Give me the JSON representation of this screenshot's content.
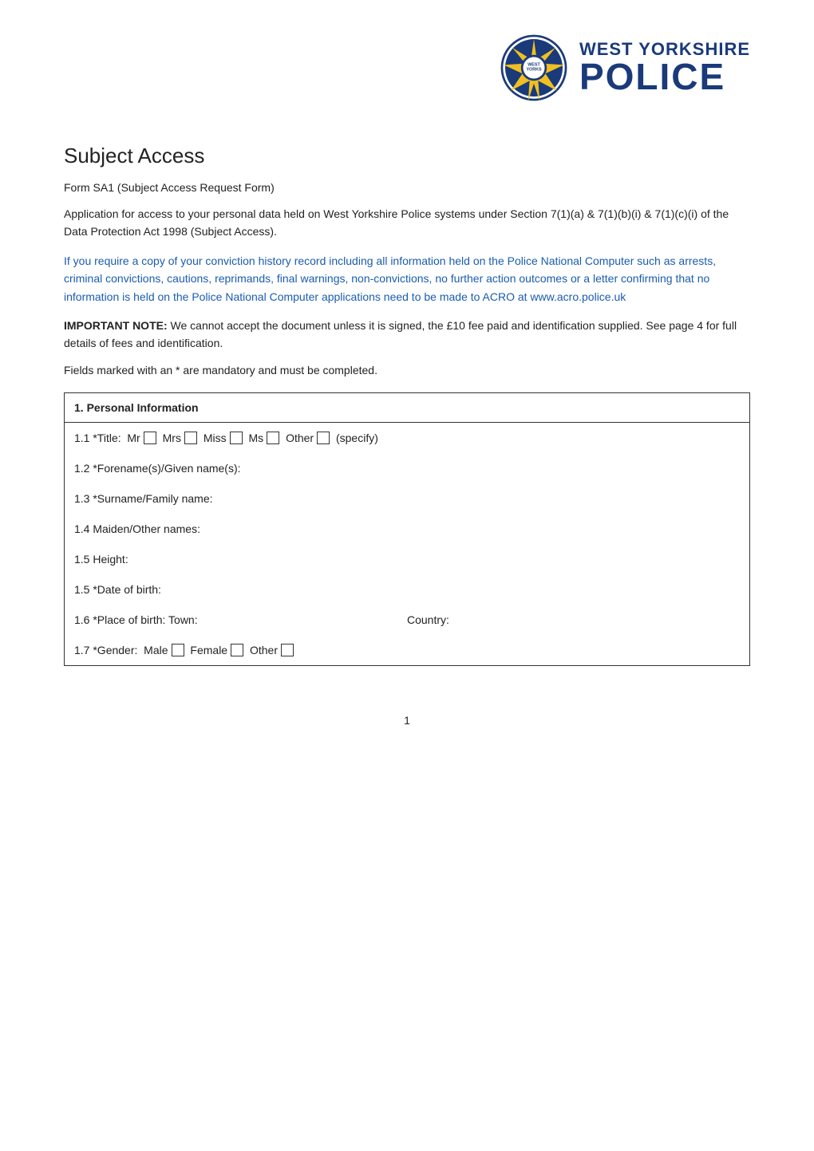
{
  "header": {
    "logo_top": "WEST YORKSHIRE",
    "logo_bottom": "POLICE"
  },
  "page": {
    "title": "Subject Access",
    "subtitle": "Form SA1 (Subject Access Request Form)",
    "intro": "Application for access to your personal data held on West Yorkshire Police systems under Section 7(1)(a) & 7(1)(b)(i) & 7(1)(c)(i) of the Data Protection Act 1998 (Subject Access).",
    "blue_notice": "If you require a copy of your conviction history record including all information held on the Police National Computer such as arrests, criminal convictions, cautions, reprimands, final warnings, non-convictions, no further action outcomes or a letter confirming that no information is held on the Police National Computer applications need to be made to ACRO at www.acro.police.uk",
    "important_note_bold": "IMPORTANT NOTE:",
    "important_note_text": " We cannot accept the document unless it is signed, the £10 fee paid and identification supplied.  See page 4 for full details of fees and identification.",
    "mandatory_note": "Fields marked with an * are mandatory and must be completed.",
    "page_number": "1"
  },
  "section1": {
    "header": "1.   Personal Information",
    "rows": [
      {
        "id": "1.1",
        "label": "1.1 *Title:  Mr",
        "type": "title_checkboxes",
        "options": [
          "Mr",
          "Mrs",
          "Miss",
          "Ms",
          "Other",
          "(specify)"
        ]
      },
      {
        "id": "1.2",
        "label": "1.2  *Forename(s)/Given name(s):",
        "type": "text_field"
      },
      {
        "id": "1.3",
        "label": "1.3 *Surname/Family name:",
        "type": "text_field"
      },
      {
        "id": "1.4",
        "label": "1.4  Maiden/Other names:",
        "type": "text_field"
      },
      {
        "id": "1.5a",
        "label": "1.5 Height:",
        "type": "text_field"
      },
      {
        "id": "1.5b",
        "label": "1.5 *Date of birth:",
        "type": "text_field"
      },
      {
        "id": "1.6",
        "label": "1.6 *Place of birth: Town:",
        "label2": "Country:",
        "type": "split_field"
      },
      {
        "id": "1.7",
        "label": "1.7 *Gender:  Male",
        "type": "gender_checkboxes",
        "options": [
          "Male",
          "Female",
          "Other"
        ]
      }
    ]
  }
}
